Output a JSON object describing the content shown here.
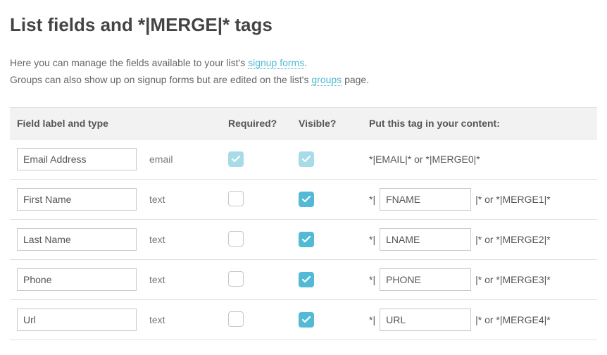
{
  "title": "List fields and *|MERGE|* tags",
  "intro": {
    "line1_pre": "Here you can manage the fields available to your list's ",
    "line1_link": "signup forms",
    "line1_post": ".",
    "line2_pre": "Groups can also show up on signup forms but are edited on the list's ",
    "line2_link": "groups",
    "line2_post": " page."
  },
  "headers": {
    "label": "Field label and type",
    "required": "Required?",
    "visible": "Visible?",
    "tag": "Put this tag in your content:"
  },
  "tag_syntax": {
    "prefix": "*|",
    "mid": "|* or *|",
    "suffix": "|*"
  },
  "rows": [
    {
      "label": "Email Address",
      "type": "email",
      "required": true,
      "required_locked": true,
      "visible": true,
      "visible_locked": true,
      "tag_editable": false,
      "tag_static": "*|EMAIL|* or *|MERGE0|*"
    },
    {
      "label": "First Name",
      "type": "text",
      "required": false,
      "required_locked": false,
      "visible": true,
      "visible_locked": false,
      "tag_editable": true,
      "tag_value": "FNAME",
      "merge_alt": "MERGE1"
    },
    {
      "label": "Last Name",
      "type": "text",
      "required": false,
      "required_locked": false,
      "visible": true,
      "visible_locked": false,
      "tag_editable": true,
      "tag_value": "LNAME",
      "merge_alt": "MERGE2"
    },
    {
      "label": "Phone",
      "type": "text",
      "required": false,
      "required_locked": false,
      "visible": true,
      "visible_locked": false,
      "tag_editable": true,
      "tag_value": "PHONE",
      "merge_alt": "MERGE3"
    },
    {
      "label": "Url",
      "type": "text",
      "required": false,
      "required_locked": false,
      "visible": true,
      "visible_locked": false,
      "tag_editable": true,
      "tag_value": "URL",
      "merge_alt": "MERGE4"
    }
  ]
}
